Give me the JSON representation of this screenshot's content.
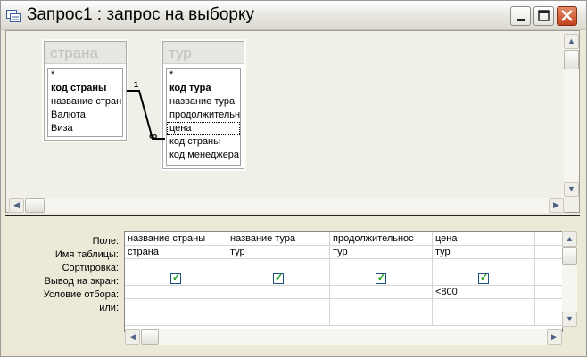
{
  "window": {
    "title": "Запрос1 : запрос на выборку"
  },
  "tables": [
    {
      "name": "страна",
      "fields": [
        "*",
        "код страны",
        "название страны",
        "Валюта",
        "Виза"
      ]
    },
    {
      "name": "тур",
      "fields": [
        "*",
        "код тура",
        "название тура",
        "продолжительно",
        "цена",
        "код страны",
        "код менеджера"
      ]
    }
  ],
  "relationship": {
    "one": "1",
    "many": "∞"
  },
  "grid": {
    "row_labels": [
      "Поле:",
      "Имя таблицы:",
      "Сортировка:",
      "Вывод на экран:",
      "Условие отбора:",
      "или:"
    ],
    "columns": [
      {
        "field": "название страны",
        "table": "страна",
        "sort": "",
        "show": true,
        "criteria": "",
        "or": ""
      },
      {
        "field": "название тура",
        "table": "тур",
        "sort": "",
        "show": true,
        "criteria": "",
        "or": ""
      },
      {
        "field": "продолжительнос",
        "table": "тур",
        "sort": "",
        "show": true,
        "criteria": "",
        "or": ""
      },
      {
        "field": "цена",
        "table": "тур",
        "sort": "",
        "show": true,
        "criteria": "<800",
        "or": ""
      }
    ]
  },
  "colors": {
    "title_bar": "#e9e8e2",
    "close_button": "#c4421d",
    "check": "#21a121"
  },
  "icons": {
    "window": "query-icon",
    "minimize": "minimize-icon",
    "maximize": "maximize-icon",
    "close": "close-icon"
  }
}
